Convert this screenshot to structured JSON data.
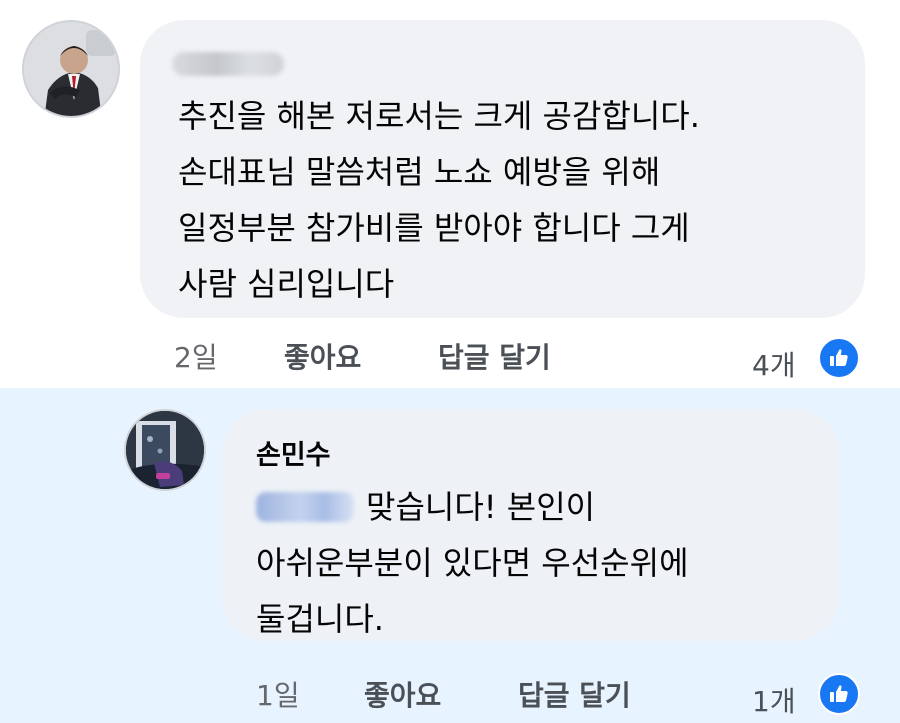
{
  "comments": [
    {
      "author": "",
      "text_lines": [
        "추진을 해본 저로서는 크게 공감합니다.",
        "손대표님 말씀처럼 노쇼 예방을 위해",
        "일정부분 참가비를 받아야 합니다 그게",
        "사람 심리입니다"
      ],
      "time": "2일",
      "like_label": "좋아요",
      "reply_label": "답글 달기",
      "reaction_count": "4개",
      "reaction_icon": "like-icon"
    },
    {
      "author": "손민수",
      "text_lines": [
        "맞습니다! 본인이",
        "아쉬운부분이 있다면 우선순위에",
        "둘겁니다."
      ],
      "time": "1일",
      "like_label": "좋아요",
      "reply_label": "답글 달기",
      "reaction_count": "1개",
      "reaction_icon": "like-icon"
    }
  ],
  "colors": {
    "like_blue": "#1877f2",
    "reply_highlight": "#e7f3ff",
    "bubble": "#f0f2f5",
    "meta_text": "#65676b"
  }
}
